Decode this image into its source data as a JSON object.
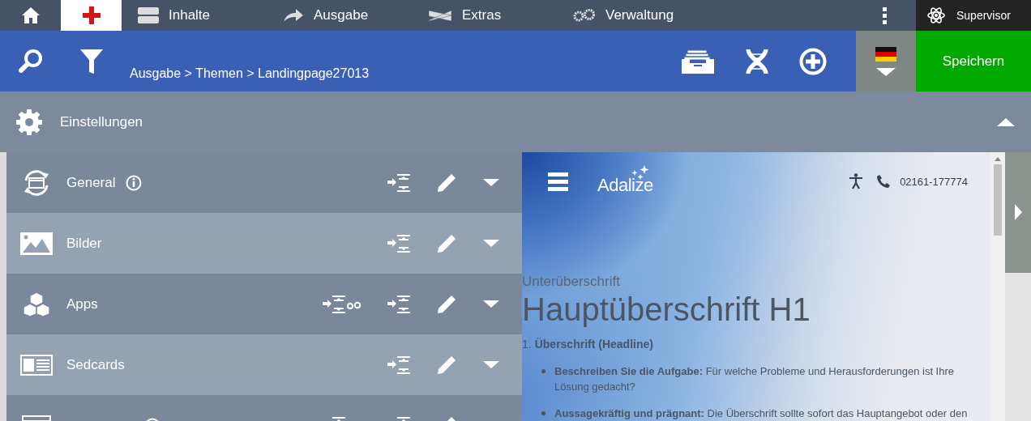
{
  "nav": [
    {
      "kind": "home",
      "selected": false
    },
    {
      "kind": "cross",
      "selected": true
    },
    {
      "kind": "drawer",
      "label": "Inhalte",
      "selected": false
    },
    {
      "kind": "arrow",
      "label": "Ausgabe",
      "selected": false
    },
    {
      "kind": "ribbon",
      "label": "Extras",
      "selected": false
    },
    {
      "kind": "gears",
      "label": "Verwaltung",
      "selected": false
    }
  ],
  "user": "Supervisor",
  "breadcrumb": "Ausgabe > Themen > Landingpage27013",
  "save_button": "Speichern",
  "settings": {
    "title": "Einstellungen",
    "expanded": true
  },
  "rows": [
    {
      "kind": "refresh",
      "label": "General",
      "info": true,
      "app_import": false
    },
    {
      "kind": "image",
      "label": "Bilder",
      "info": false,
      "app_import": false
    },
    {
      "kind": "cubes",
      "label": "Apps",
      "info": false,
      "app_import": true
    },
    {
      "kind": "card",
      "label": "Sedcards",
      "info": false,
      "app_import": false
    },
    {
      "kind": "table",
      "info": true,
      "app_import": true
    }
  ],
  "preview": {
    "logo": "Adalize",
    "phone": "02161-177774",
    "subtitle": "Unterüberschrift",
    "heading": "Hauptüberschrift H1",
    "section": "Überschrift (Headline)",
    "section_number": "1.",
    "bullets": [
      "**Beschreiben Sie die Aufgabe:** Für welche Probleme und Herausforderungen ist Ihre Lösung gedacht?",
      "**Aussagekräftig und prägnant:** Die Überschrift sollte sofort das Hauptangebot oder den"
    ]
  }
}
